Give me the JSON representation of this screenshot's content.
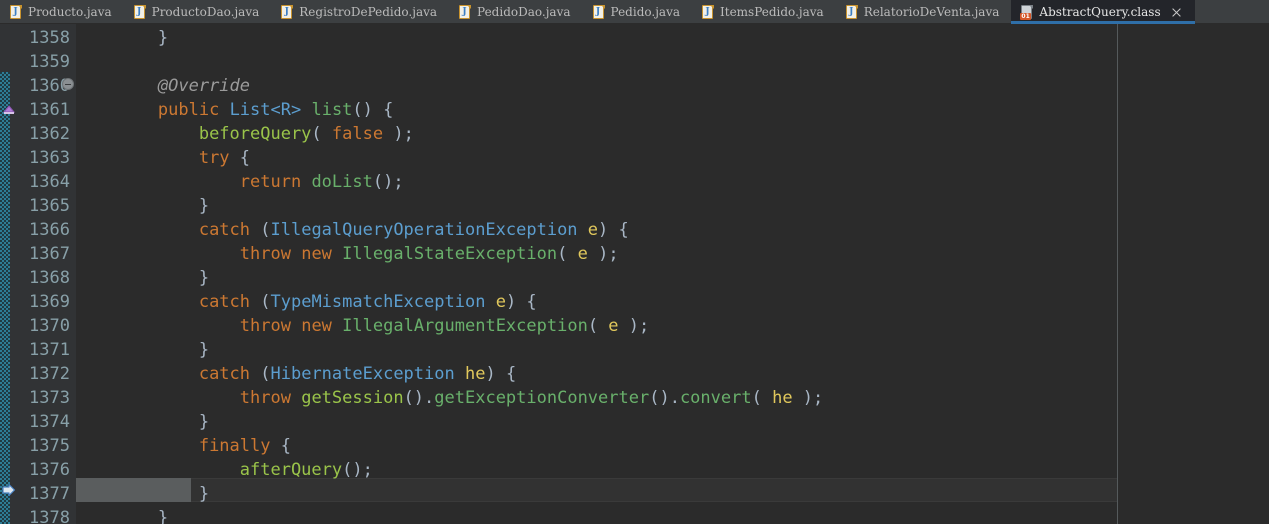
{
  "window": {
    "app": "IntelliJ IDEA Editor",
    "colors": {
      "editor_bg": "#2b2b2b",
      "gutter_bg": "#313335",
      "tabbar_bg": "#3c3f41",
      "active_tab_bg": "#23252a",
      "active_tab_underline": "#2f6fa8",
      "current_line_bg": "#323232",
      "selection_bg": "#5a5d5e",
      "line_number_fg": "#88a0a8",
      "default_text": "#a9b7c6",
      "keyword": "#cc7832",
      "type": "#5c9ecf",
      "method": "#69b06b",
      "method_decl": "#9ac44a",
      "variable": "#e1c85c",
      "annotation": "#9b9b9b",
      "change_stripe": "#2e7d96"
    }
  },
  "tabbar": {
    "tabs": [
      {
        "label": "Producto.java",
        "icon": "java-file-icon",
        "icon_glyph": "J",
        "active": false
      },
      {
        "label": "ProductoDao.java",
        "icon": "java-file-icon",
        "icon_glyph": "J",
        "active": false
      },
      {
        "label": "RegistroDePedido.java",
        "icon": "java-file-icon",
        "icon_glyph": "J",
        "active": false
      },
      {
        "label": "PedidoDao.java",
        "icon": "java-file-icon",
        "icon_glyph": "J",
        "active": false
      },
      {
        "label": "Pedido.java",
        "icon": "java-file-icon",
        "icon_glyph": "J",
        "active": false
      },
      {
        "label": "ItemsPedido.java",
        "icon": "java-file-icon",
        "icon_glyph": "J",
        "active": false
      },
      {
        "label": "RelatorioDeVenta.java",
        "icon": "java-file-icon",
        "icon_glyph": "J",
        "active": false
      },
      {
        "label": "AbstractQuery.class",
        "icon": "class-file-icon",
        "icon_glyph": "01",
        "active": true,
        "close_icon": "close-icon"
      }
    ]
  },
  "gutter": {
    "markers": [
      {
        "line": 1360,
        "icon": "fold-collapse-icon",
        "name": "code-fold-collapse-marker"
      },
      {
        "line": 1361,
        "icon": "override-method-icon",
        "name": "override-implementation-marker"
      },
      {
        "line": 1377,
        "icon": "execution-point-icon",
        "name": "execution-point-marker"
      }
    ],
    "line_numbers": [
      1358,
      1359,
      1360,
      1361,
      1362,
      1363,
      1364,
      1365,
      1366,
      1367,
      1368,
      1369,
      1370,
      1371,
      1372,
      1373,
      1374,
      1375,
      1376,
      1377,
      1378
    ]
  },
  "editor": {
    "current_line": 1377,
    "selection_text": "            }",
    "right_margin_column_x": 1117,
    "lines": [
      {
        "n": 1358,
        "tokens": [
          {
            "t": "        }",
            "c": "pun"
          }
        ]
      },
      {
        "n": 1359,
        "tokens": [
          {
            "t": "",
            "c": "pun"
          }
        ]
      },
      {
        "n": 1360,
        "tokens": [
          {
            "t": "        ",
            "c": "pun"
          },
          {
            "t": "@Override",
            "c": "ann"
          }
        ]
      },
      {
        "n": 1361,
        "tokens": [
          {
            "t": "        ",
            "c": "pun"
          },
          {
            "t": "public",
            "c": "kw"
          },
          {
            "t": " ",
            "c": "pun"
          },
          {
            "t": "List<R>",
            "c": "typ"
          },
          {
            "t": " ",
            "c": "pun"
          },
          {
            "t": "list",
            "c": "mth"
          },
          {
            "t": "() {",
            "c": "pun"
          }
        ]
      },
      {
        "n": 1362,
        "tokens": [
          {
            "t": "            ",
            "c": "pun"
          },
          {
            "t": "beforeQuery",
            "c": "mthy"
          },
          {
            "t": "( ",
            "c": "pun"
          },
          {
            "t": "false",
            "c": "kw"
          },
          {
            "t": " );",
            "c": "pun"
          }
        ]
      },
      {
        "n": 1363,
        "tokens": [
          {
            "t": "            ",
            "c": "pun"
          },
          {
            "t": "try",
            "c": "kw"
          },
          {
            "t": " {",
            "c": "pun"
          }
        ]
      },
      {
        "n": 1364,
        "tokens": [
          {
            "t": "                ",
            "c": "pun"
          },
          {
            "t": "return",
            "c": "kw"
          },
          {
            "t": " ",
            "c": "pun"
          },
          {
            "t": "doList",
            "c": "mth"
          },
          {
            "t": "();",
            "c": "pun"
          }
        ]
      },
      {
        "n": 1365,
        "tokens": [
          {
            "t": "            }",
            "c": "pun"
          }
        ]
      },
      {
        "n": 1366,
        "tokens": [
          {
            "t": "            ",
            "c": "pun"
          },
          {
            "t": "catch",
            "c": "kw"
          },
          {
            "t": " (",
            "c": "pun"
          },
          {
            "t": "IllegalQueryOperationException",
            "c": "typ"
          },
          {
            "t": " ",
            "c": "pun"
          },
          {
            "t": "e",
            "c": "var"
          },
          {
            "t": ") {",
            "c": "pun"
          }
        ]
      },
      {
        "n": 1367,
        "tokens": [
          {
            "t": "                ",
            "c": "pun"
          },
          {
            "t": "throw",
            "c": "kw"
          },
          {
            "t": " ",
            "c": "pun"
          },
          {
            "t": "new",
            "c": "kw"
          },
          {
            "t": " ",
            "c": "pun"
          },
          {
            "t": "IllegalStateException",
            "c": "mth"
          },
          {
            "t": "( ",
            "c": "pun"
          },
          {
            "t": "e",
            "c": "var"
          },
          {
            "t": " );",
            "c": "pun"
          }
        ]
      },
      {
        "n": 1368,
        "tokens": [
          {
            "t": "            }",
            "c": "pun"
          }
        ]
      },
      {
        "n": 1369,
        "tokens": [
          {
            "t": "            ",
            "c": "pun"
          },
          {
            "t": "catch",
            "c": "kw"
          },
          {
            "t": " (",
            "c": "pun"
          },
          {
            "t": "TypeMismatchException",
            "c": "typ"
          },
          {
            "t": " ",
            "c": "pun"
          },
          {
            "t": "e",
            "c": "var"
          },
          {
            "t": ") {",
            "c": "pun"
          }
        ]
      },
      {
        "n": 1370,
        "tokens": [
          {
            "t": "                ",
            "c": "pun"
          },
          {
            "t": "throw",
            "c": "kw"
          },
          {
            "t": " ",
            "c": "pun"
          },
          {
            "t": "new",
            "c": "kw"
          },
          {
            "t": " ",
            "c": "pun"
          },
          {
            "t": "IllegalArgumentException",
            "c": "mth"
          },
          {
            "t": "( ",
            "c": "pun"
          },
          {
            "t": "e",
            "c": "var"
          },
          {
            "t": " );",
            "c": "pun"
          }
        ]
      },
      {
        "n": 1371,
        "tokens": [
          {
            "t": "            }",
            "c": "pun"
          }
        ]
      },
      {
        "n": 1372,
        "tokens": [
          {
            "t": "            ",
            "c": "pun"
          },
          {
            "t": "catch",
            "c": "kw"
          },
          {
            "t": " (",
            "c": "pun"
          },
          {
            "t": "HibernateException",
            "c": "typ"
          },
          {
            "t": " ",
            "c": "pun"
          },
          {
            "t": "he",
            "c": "var"
          },
          {
            "t": ") {",
            "c": "pun"
          }
        ]
      },
      {
        "n": 1373,
        "tokens": [
          {
            "t": "                ",
            "c": "pun"
          },
          {
            "t": "throw",
            "c": "kw"
          },
          {
            "t": " ",
            "c": "pun"
          },
          {
            "t": "getSession",
            "c": "mthy"
          },
          {
            "t": "().",
            "c": "pun"
          },
          {
            "t": "getExceptionConverter",
            "c": "mth"
          },
          {
            "t": "().",
            "c": "pun"
          },
          {
            "t": "convert",
            "c": "mth"
          },
          {
            "t": "( ",
            "c": "pun"
          },
          {
            "t": "he",
            "c": "var"
          },
          {
            "t": " );",
            "c": "pun"
          }
        ]
      },
      {
        "n": 1374,
        "tokens": [
          {
            "t": "            }",
            "c": "pun"
          }
        ]
      },
      {
        "n": 1375,
        "tokens": [
          {
            "t": "            ",
            "c": "pun"
          },
          {
            "t": "finally",
            "c": "kw"
          },
          {
            "t": " {",
            "c": "pun"
          }
        ]
      },
      {
        "n": 1376,
        "tokens": [
          {
            "t": "                ",
            "c": "pun"
          },
          {
            "t": "afterQuery",
            "c": "mthy"
          },
          {
            "t": "();",
            "c": "pun"
          }
        ]
      },
      {
        "n": 1377,
        "tokens": [
          {
            "t": "            }",
            "c": "pun"
          }
        ]
      },
      {
        "n": 1378,
        "tokens": [
          {
            "t": "        }",
            "c": "pun"
          }
        ]
      }
    ]
  }
}
